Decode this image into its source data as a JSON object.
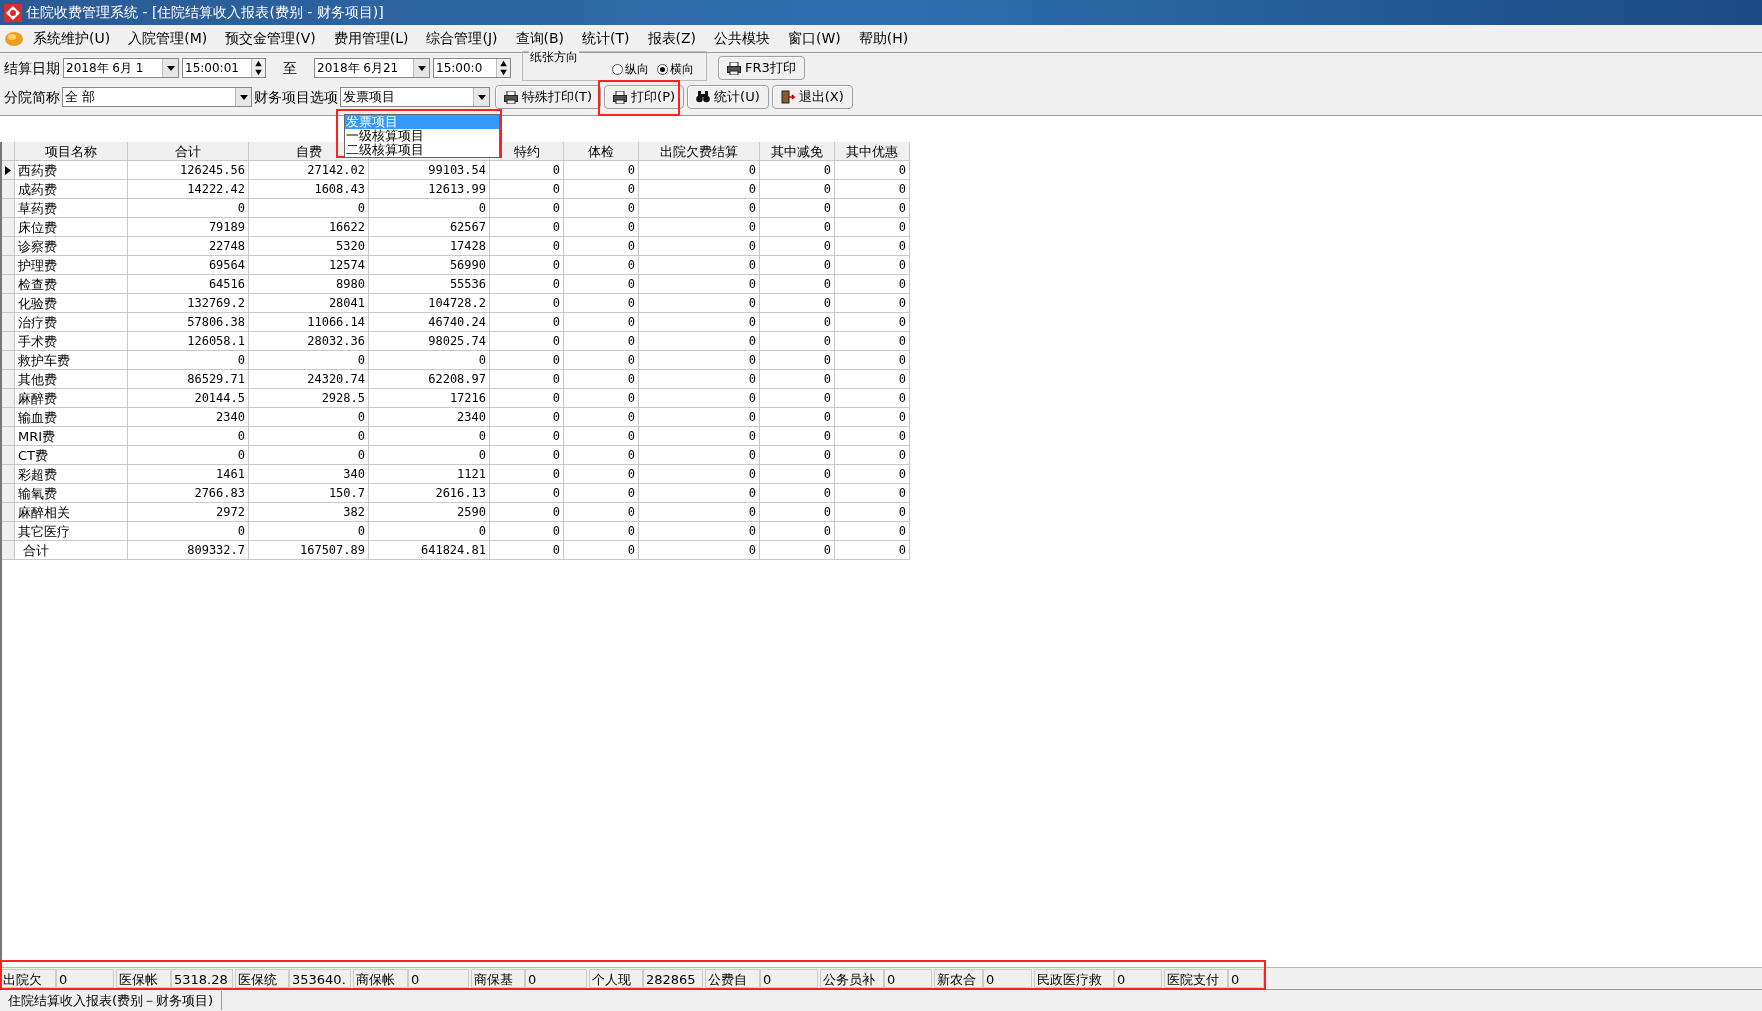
{
  "window": {
    "title": "住院收费管理系统 - [住院结算收入报表(费别 - 财务项目)]"
  },
  "menu": [
    {
      "label": "系统维护(U)"
    },
    {
      "label": "入院管理(M)"
    },
    {
      "label": "预交金管理(V)"
    },
    {
      "label": "费用管理(L)"
    },
    {
      "label": "综合管理(J)"
    },
    {
      "label": "查询(B)"
    },
    {
      "label": "统计(T)"
    },
    {
      "label": "报表(Z)"
    },
    {
      "label": "公共模块"
    },
    {
      "label": "窗口(W)"
    },
    {
      "label": "帮助(H)"
    }
  ],
  "filters": {
    "date_label": "结算日期",
    "start_date": "2018年 6月 1",
    "start_time": "15:00:01",
    "to_label": "至",
    "end_date": "2018年 6月21",
    "end_time": "15:00:0",
    "paper_orientation": {
      "title": "纸张方向",
      "options": [
        {
          "label": "纵向",
          "selected": false
        },
        {
          "label": "横向",
          "selected": true
        }
      ]
    },
    "fr3_button": "FR3打印",
    "branch_label": "分院简称",
    "branch_value": "全 部",
    "finance_label": "财务项目选项",
    "finance_value": "发票项目",
    "finance_options": [
      {
        "label": "发票项目",
        "selected": true
      },
      {
        "label": "一级核算项目",
        "selected": false
      },
      {
        "label": "二级核算项目",
        "selected": false
      }
    ],
    "buttons": [
      {
        "label": "特殊打印(T)"
      },
      {
        "label": "打印(P)"
      },
      {
        "label": "统计(U)"
      },
      {
        "label": "退出(X)"
      }
    ]
  },
  "table": {
    "columns": [
      {
        "kind": "text",
        "label": "项目名称"
      },
      {
        "kind": "text",
        "label": "合计"
      },
      {
        "kind": "text",
        "label": "自费"
      },
      {
        "kind": "covered"
      },
      {
        "kind": "text",
        "label": "特约"
      },
      {
        "kind": "text",
        "label": "体检"
      },
      {
        "kind": "text",
        "label": "出院欠费结算"
      },
      {
        "kind": "text",
        "label": "其中减免"
      },
      {
        "kind": "text",
        "label": "其中优惠"
      }
    ],
    "rows": [
      {
        "name": "西药费",
        "selected": true,
        "values": [
          "126245.56",
          "27142.02",
          "99103.54",
          "0",
          "0",
          "0",
          "0",
          "0"
        ]
      },
      {
        "name": "成药费",
        "selected": false,
        "values": [
          "14222.42",
          "1608.43",
          "12613.99",
          "0",
          "0",
          "0",
          "0",
          "0"
        ]
      },
      {
        "name": "草药费",
        "selected": false,
        "values": [
          "0",
          "0",
          "0",
          "0",
          "0",
          "0",
          "0",
          "0"
        ]
      },
      {
        "name": "床位费",
        "selected": false,
        "values": [
          "79189",
          "16622",
          "62567",
          "0",
          "0",
          "0",
          "0",
          "0"
        ]
      },
      {
        "name": "诊察费",
        "selected": false,
        "values": [
          "22748",
          "5320",
          "17428",
          "0",
          "0",
          "0",
          "0",
          "0"
        ]
      },
      {
        "name": "护理费",
        "selected": false,
        "values": [
          "69564",
          "12574",
          "56990",
          "0",
          "0",
          "0",
          "0",
          "0"
        ]
      },
      {
        "name": "检查费",
        "selected": false,
        "values": [
          "64516",
          "8980",
          "55536",
          "0",
          "0",
          "0",
          "0",
          "0"
        ]
      },
      {
        "name": "化验费",
        "selected": false,
        "values": [
          "132769.2",
          "28041",
          "104728.2",
          "0",
          "0",
          "0",
          "0",
          "0"
        ]
      },
      {
        "name": "治疗费",
        "selected": false,
        "values": [
          "57806.38",
          "11066.14",
          "46740.24",
          "0",
          "0",
          "0",
          "0",
          "0"
        ]
      },
      {
        "name": "手术费",
        "selected": false,
        "values": [
          "126058.1",
          "28032.36",
          "98025.74",
          "0",
          "0",
          "0",
          "0",
          "0"
        ]
      },
      {
        "name": "救护车费",
        "selected": false,
        "values": [
          "0",
          "0",
          "0",
          "0",
          "0",
          "0",
          "0",
          "0"
        ]
      },
      {
        "name": "其他费",
        "selected": false,
        "values": [
          "86529.71",
          "24320.74",
          "62208.97",
          "0",
          "0",
          "0",
          "0",
          "0"
        ]
      },
      {
        "name": "麻醉费",
        "selected": false,
        "values": [
          "20144.5",
          "2928.5",
          "17216",
          "0",
          "0",
          "0",
          "0",
          "0"
        ]
      },
      {
        "name": "输血费",
        "selected": false,
        "values": [
          "2340",
          "0",
          "2340",
          "0",
          "0",
          "0",
          "0",
          "0"
        ]
      },
      {
        "name": "MRI费",
        "selected": false,
        "values": [
          "0",
          "0",
          "0",
          "0",
          "0",
          "0",
          "0",
          "0"
        ]
      },
      {
        "name": "CT费",
        "selected": false,
        "values": [
          "0",
          "0",
          "0",
          "0",
          "0",
          "0",
          "0",
          "0"
        ]
      },
      {
        "name": "彩超费",
        "selected": false,
        "values": [
          "1461",
          "340",
          "1121",
          "0",
          "0",
          "0",
          "0",
          "0"
        ]
      },
      {
        "name": "输氧费",
        "selected": false,
        "values": [
          "2766.83",
          "150.7",
          "2616.13",
          "0",
          "0",
          "0",
          "0",
          "0"
        ]
      },
      {
        "name": "麻醉相关",
        "selected": false,
        "values": [
          "2972",
          "382",
          "2590",
          "0",
          "0",
          "0",
          "0",
          "0"
        ]
      },
      {
        "name": "其它医疗",
        "selected": false,
        "values": [
          "0",
          "0",
          "0",
          "0",
          "0",
          "0",
          "0",
          "0"
        ]
      }
    ],
    "total_row": {
      "name": "合计",
      "values": [
        "809332.7",
        "167507.89",
        "641824.81",
        "0",
        "0",
        "0",
        "0",
        "0"
      ]
    }
  },
  "summary_fields": [
    {
      "label": "出院欠",
      "value": "0"
    },
    {
      "label": "医保帐",
      "value": "5318.28"
    },
    {
      "label": "医保统",
      "value": "353640."
    },
    {
      "label": "商保帐",
      "value": "0"
    },
    {
      "label": "商保基",
      "value": "0"
    },
    {
      "label": "个人现",
      "value": "282865"
    },
    {
      "label": "公费自",
      "value": "0"
    },
    {
      "label": "公务员补",
      "value": "0"
    },
    {
      "label": "新农合",
      "value": "0"
    },
    {
      "label": "民政医疗救",
      "value": "0"
    },
    {
      "label": "医院支付",
      "value": "0"
    }
  ],
  "status_bar": {
    "text": "住院结算收入报表(费别－财务项目)"
  }
}
